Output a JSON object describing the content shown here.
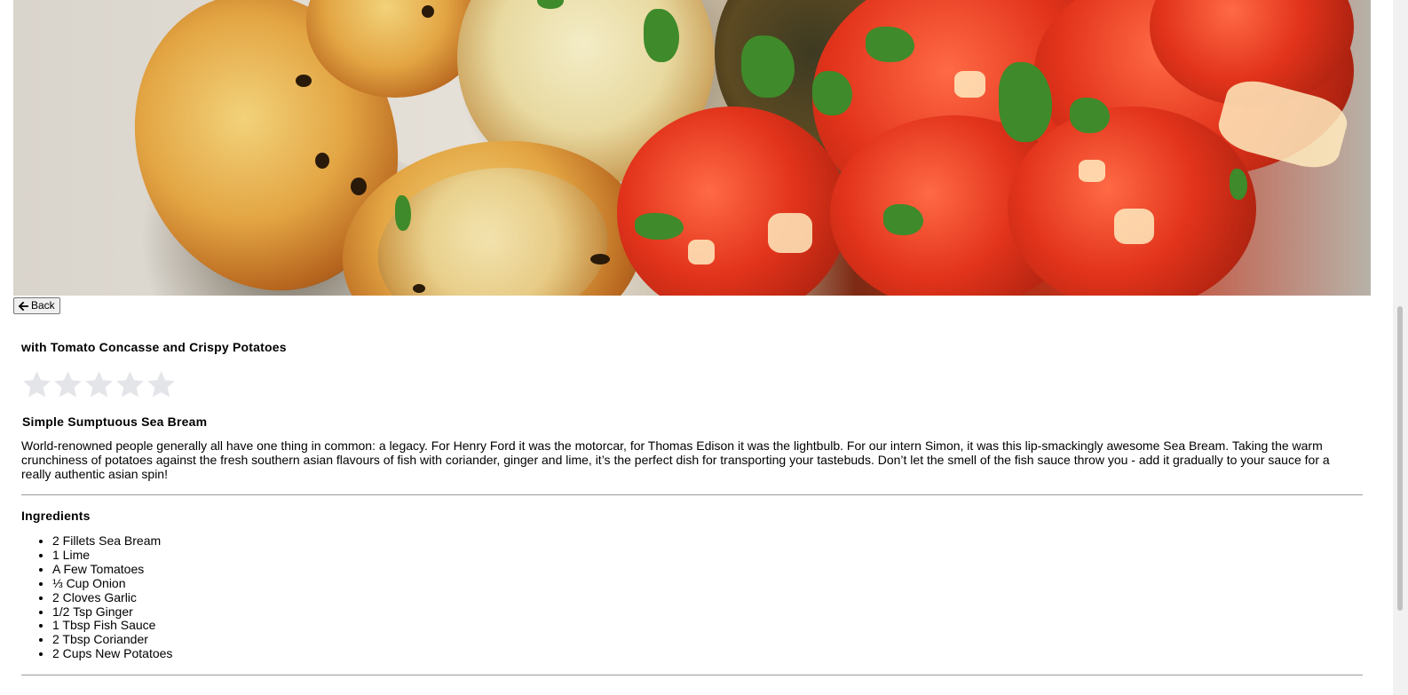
{
  "hero": {
    "image_alt_name": "sea-bream-dish-photo"
  },
  "back_button": {
    "icon": "arrow-left-icon",
    "label": "Back"
  },
  "recipe": {
    "subtitle": "with Tomato Concasse and Crispy Potatoes",
    "rating": {
      "filled": 0,
      "max": 5,
      "empty_color": "#e4e5e9"
    },
    "name": "Simple Sumptuous Sea Bream",
    "description": "World-renowned people generally all have one thing in common: a legacy. For Henry Ford it was the motorcar, for Thomas Edison it was the lightbulb. For our intern Simon, it was this lip-smackingly awesome Sea Bream. Taking the warm crunchiness of potatoes against the fresh southern asian flavours of fish with coriander, ginger and lime, it’s the perfect dish for transporting your tastebuds. Don’t let the smell of the fish sauce throw you - add it gradually to your sauce for a really authentic asian spin!",
    "ingredients_title": "Ingredients",
    "ingredients": [
      "2 Fillets Sea Bream",
      "1 Lime",
      "A Few Tomatoes",
      "⅓ Cup Onion",
      "2 Cloves Garlic",
      "1/2 Tsp Ginger",
      "1 Tbsp Fish Sauce",
      "2 Tbsp Coriander",
      "2 Cups New Potatoes"
    ]
  }
}
